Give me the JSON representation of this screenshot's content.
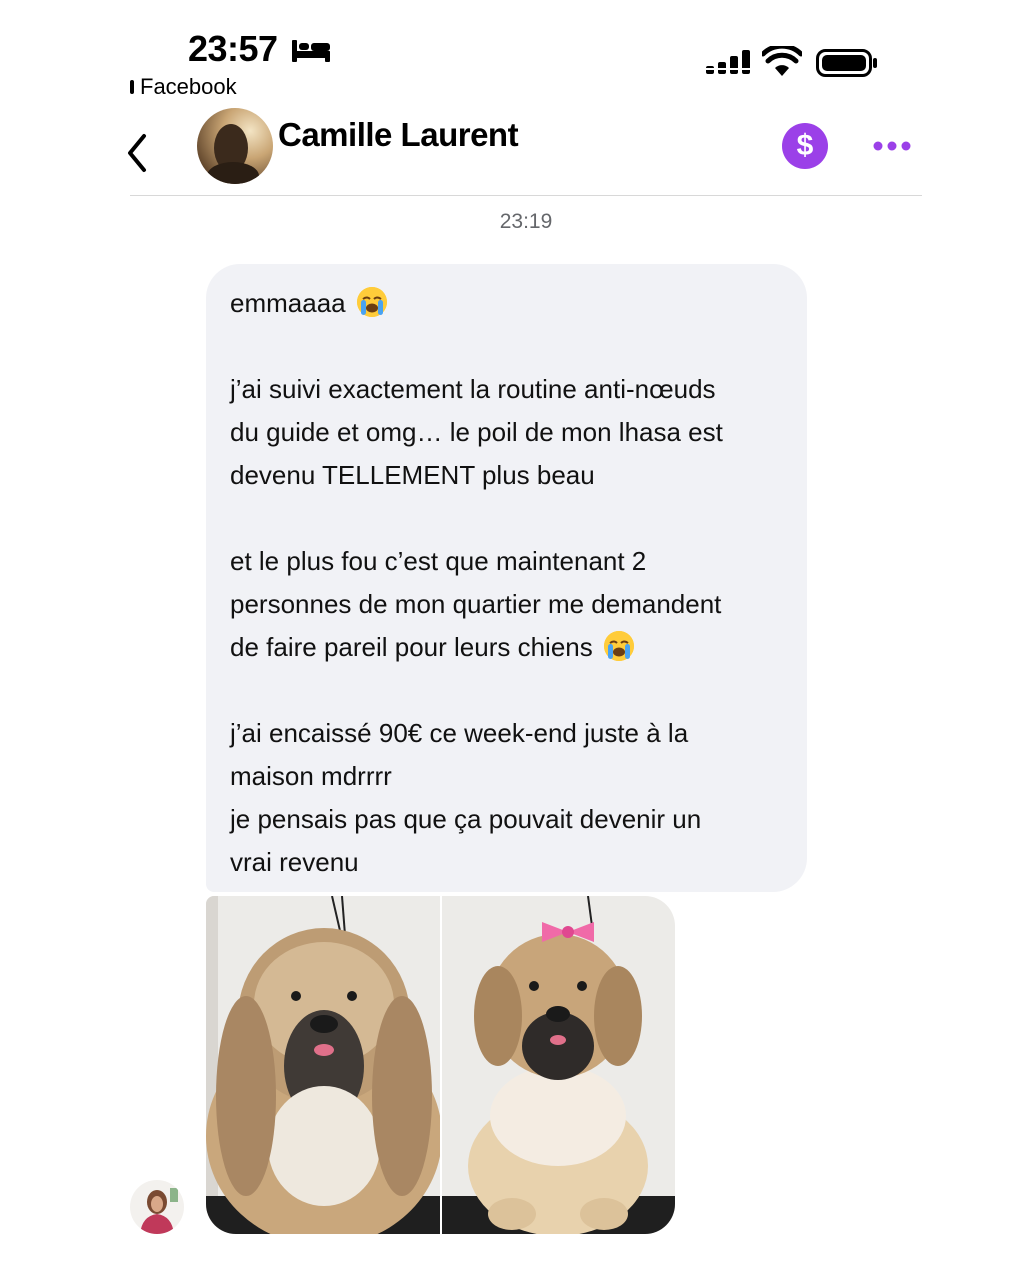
{
  "status_bar": {
    "time": "23:57",
    "back_app_label": "Facebook",
    "icons": [
      "bed-icon",
      "signal-icon",
      "wifi-icon",
      "battery-icon"
    ]
  },
  "header": {
    "contact_name": "Camille Laurent",
    "pay_symbol": "$",
    "icons": [
      "back-icon",
      "payment-icon",
      "more-icon"
    ]
  },
  "conversation": {
    "timestamp": "23:19",
    "message": {
      "lines": [
        "emmaaaa",
        "",
        "j’ai suivi exactement la routine anti-nœuds",
        "du guide et omg… le poil de mon lhasa est",
        "devenu TELLEMENT plus beau",
        "",
        "et le plus fou c’est que maintenant 2",
        "personnes de mon quartier me demandent",
        "de faire pareil pour leurs chiens",
        "",
        "j’ai encaissé 90€ ce week-end juste à la",
        "maison mdrrrr",
        "je pensais pas que ça pouvait devenir un",
        "vrai revenu"
      ],
      "emoji": "loudly-crying-face-emoji"
    },
    "photos": [
      "dog-before-grooming",
      "dog-after-grooming"
    ]
  },
  "colors": {
    "accent": "#9b40e8",
    "bubble": "#f1f2f6",
    "timestamp": "#65676b"
  }
}
